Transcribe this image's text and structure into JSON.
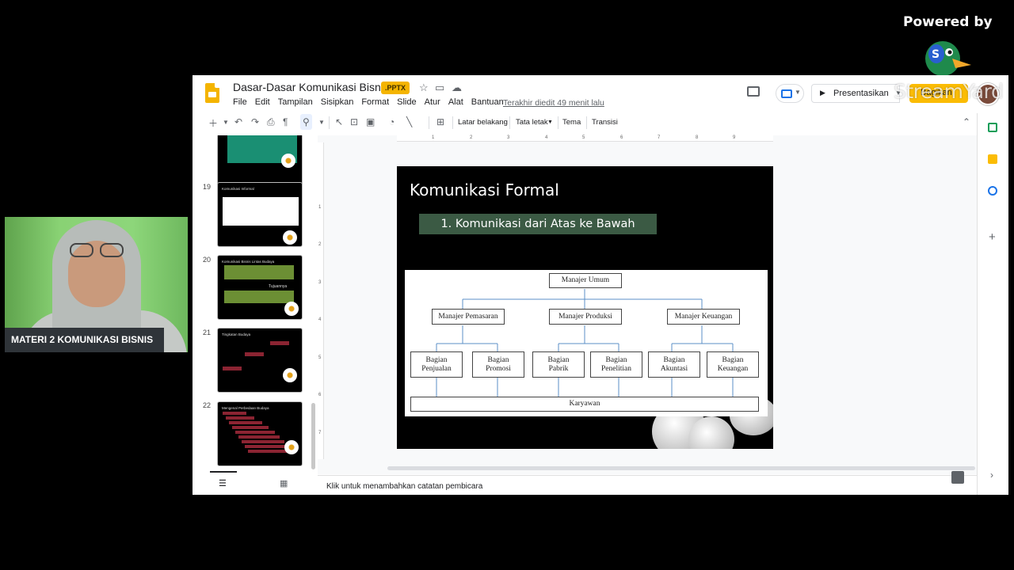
{
  "overlay": {
    "powered_by": "Powered by",
    "watermark": "StreamYard",
    "camera_label": "MATERI 2 KOMUNIKASI BISNIS"
  },
  "app": {
    "doc_title": "Dasar-Dasar Komunikasi Bisnis",
    "file_badge": ".PPTX",
    "menu": [
      "File",
      "Edit",
      "Tampilan",
      "Sisipkan",
      "Format",
      "Slide",
      "Atur",
      "Alat",
      "Bantuan"
    ],
    "last_edit": "Terakhir diedit 49 menit lalu",
    "present_label": "Presentasikan",
    "share_label": "Bagikan"
  },
  "toolbar": {
    "background": "Latar belakang",
    "layout": "Tata letak",
    "theme": "Tema",
    "transition": "Transisi"
  },
  "filmstrip": {
    "slides": [
      {
        "num": "",
        "title": ""
      },
      {
        "num": "19",
        "title": "Komunikasi Informal"
      },
      {
        "num": "20",
        "title": "Komunikasi Bisnis Lintas Budaya"
      },
      {
        "num": "21",
        "title": "Tingkatan Budaya"
      },
      {
        "num": "22",
        "title": "Mengenal Perbedaan Budaya"
      }
    ],
    "slide20_label": "Tujuannya"
  },
  "ruler": {
    "top_ticks": [
      "1",
      "2",
      "3",
      "4",
      "5",
      "6",
      "7",
      "8",
      "9"
    ],
    "left_ticks": [
      "1",
      "2",
      "3",
      "4",
      "5",
      "6",
      "7"
    ]
  },
  "slide": {
    "title": "Komunikasi Formal",
    "subtitle": "1. Komunikasi dari Atas ke Bawah",
    "org": {
      "top": "Manajer Umum",
      "managers": [
        "Manajer Pemasaran",
        "Manajer Produksi",
        "Manajer Keuangan"
      ],
      "departments": [
        [
          "Bagian",
          "Penjualan"
        ],
        [
          "Bagian",
          "Promosi"
        ],
        [
          "Bagian",
          "Pabrik"
        ],
        [
          "Bagian",
          "Penelitian"
        ],
        [
          "Bagian",
          "Akuntasi"
        ],
        [
          "Bagian",
          "Keuangan"
        ]
      ],
      "bottom": "Karyawan"
    }
  },
  "notes": {
    "placeholder": "Klik untuk menambahkan catatan pembicara"
  },
  "colors": {
    "slides_yellow": "#f4b400",
    "subtitle_bg": "#3b5a44",
    "share_yellow": "#fbbc04",
    "camera_bg": "#7bc86a"
  }
}
